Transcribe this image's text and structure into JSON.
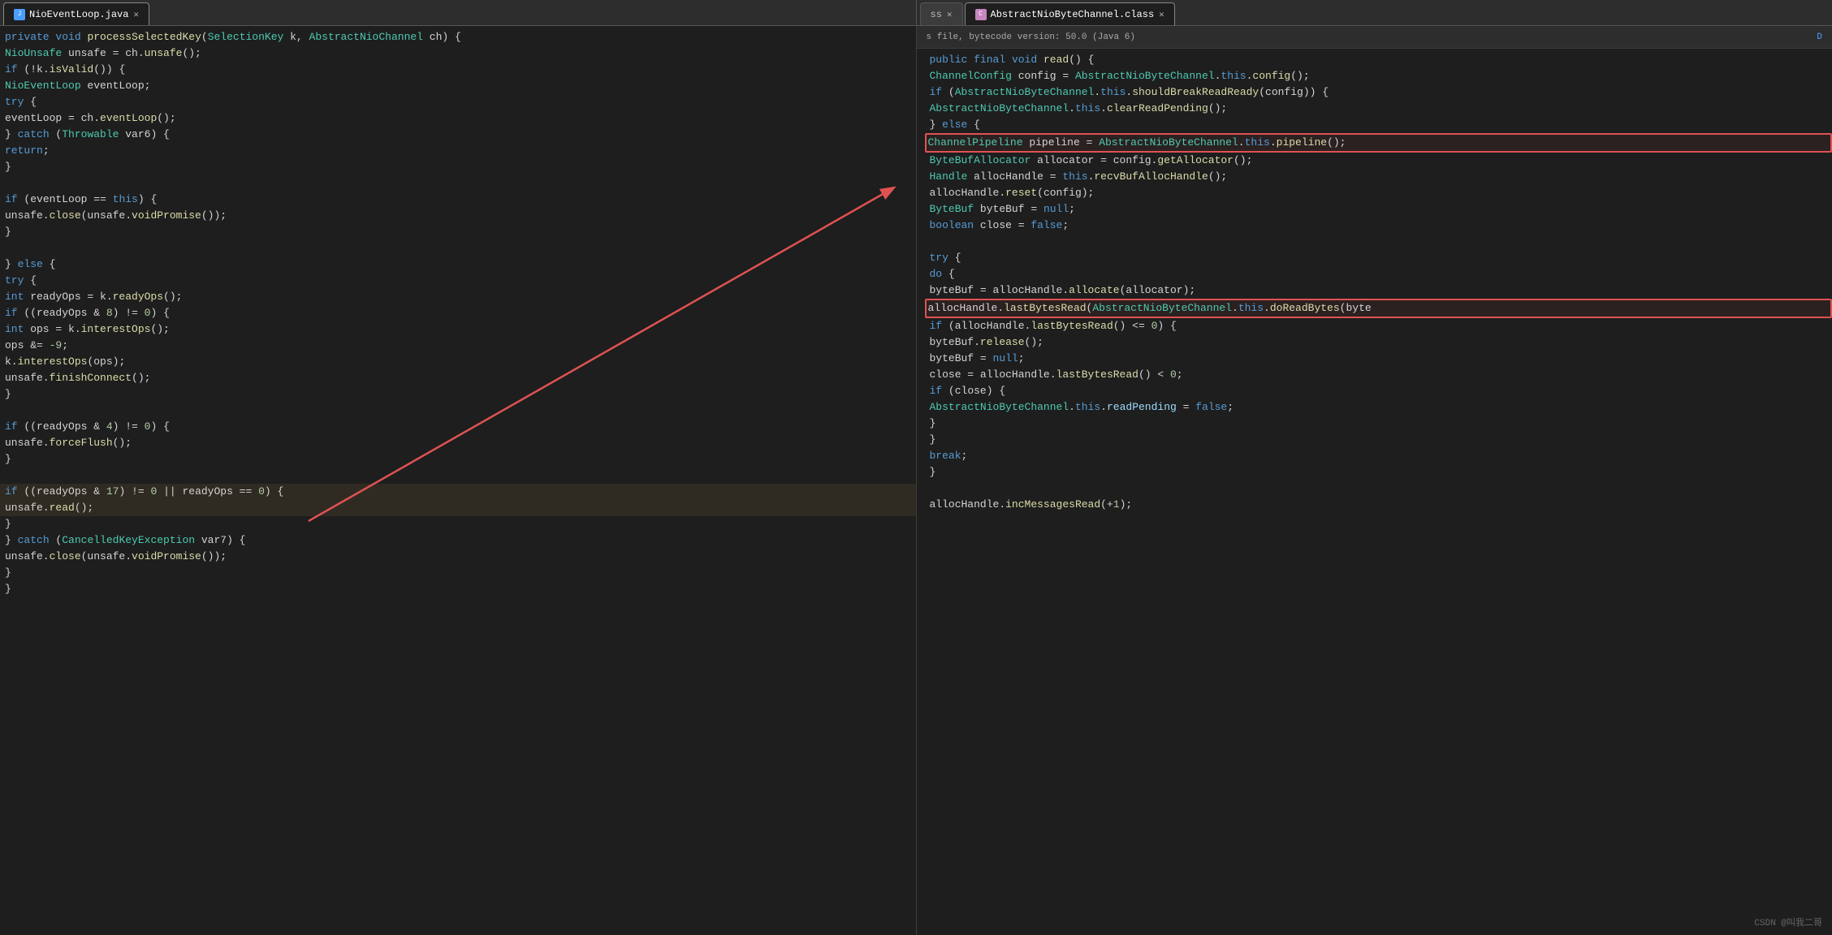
{
  "tabs": {
    "left": {
      "items": [
        {
          "label": "NioEventLoop.java",
          "active": false,
          "icon": "java"
        }
      ]
    },
    "right": {
      "items": [
        {
          "label": "ss",
          "active": false,
          "icon": "java"
        },
        {
          "label": "AbstractNioByteChannel.class",
          "active": true,
          "icon": "class"
        }
      ]
    }
  },
  "left_info": "private void processSelectedKey(SelectionKey k, AbstractNioChannel ch) {",
  "right_info": "s file, bytecode version: 50.0 (Java 6)",
  "right_badge": "D",
  "left_code": [
    {
      "num": "",
      "text": "private void processSelectedKey(SelectionKey k, AbstractNioChannel ch) {"
    },
    {
      "num": "",
      "text": "    NioUnsafe unsafe = ch.unsafe();"
    },
    {
      "num": "",
      "text": "    if (!k.isValid()) {"
    },
    {
      "num": "",
      "text": "        NioEventLoop eventLoop;"
    },
    {
      "num": "",
      "text": "        try {"
    },
    {
      "num": "",
      "text": "            eventLoop = ch.eventLoop();"
    },
    {
      "num": "",
      "text": "        } catch (Throwable var6) {"
    },
    {
      "num": "",
      "text": "            return;"
    },
    {
      "num": "",
      "text": "        }"
    },
    {
      "num": "",
      "text": ""
    },
    {
      "num": "",
      "text": "        if (eventLoop == this) {"
    },
    {
      "num": "",
      "text": "            unsafe.close(unsafe.voidPromise());"
    },
    {
      "num": "",
      "text": "        }"
    },
    {
      "num": "",
      "text": ""
    },
    {
      "num": "",
      "text": "    } else {"
    },
    {
      "num": "",
      "text": "        try {"
    },
    {
      "num": "",
      "text": "            int readyOps = k.readyOps();"
    },
    {
      "num": "",
      "text": "            if ((readyOps & 8) != 0) {"
    },
    {
      "num": "",
      "text": "                int ops = k.interestOps();"
    },
    {
      "num": "",
      "text": "                ops &= -9;"
    },
    {
      "num": "",
      "text": "                k.interestOps(ops);"
    },
    {
      "num": "",
      "text": "                unsafe.finishConnect();"
    },
    {
      "num": "",
      "text": "            }"
    },
    {
      "num": "",
      "text": ""
    },
    {
      "num": "",
      "text": "            if ((readyOps & 4) != 0) {"
    },
    {
      "num": "",
      "text": "                unsafe.forceFlush();"
    },
    {
      "num": "",
      "text": "            }"
    },
    {
      "num": "",
      "text": ""
    },
    {
      "num": "",
      "text": "            if ((readyOps & 17) != 0 || readyOps == 0) {"
    },
    {
      "num": "",
      "text": "                unsafe.read();"
    },
    {
      "num": "",
      "text": "            }"
    },
    {
      "num": "",
      "text": "        } catch (CancelledKeyException var7) {"
    },
    {
      "num": "",
      "text": "            unsafe.close(unsafe.voidPromise());"
    },
    {
      "num": "",
      "text": "        }"
    },
    {
      "num": "",
      "text": "    }"
    }
  ],
  "right_code": [
    {
      "text": "    public final void read() {"
    },
    {
      "text": "        ChannelConfig config = AbstractNioByteChannel.this.config();"
    },
    {
      "text": "        if (AbstractNioByteChannel.this.shouldBreakReadReady(config)) {"
    },
    {
      "text": "            AbstractNioByteChannel.this.clearReadPending();"
    },
    {
      "text": "        } else {"
    },
    {
      "text": "            ChannelPipeline pipeline = AbstractNioByteChannel.this.pipeline();",
      "box": true
    },
    {
      "text": "            ByteBufAllocator allocator = config.getAllocator();"
    },
    {
      "text": "            Handle allocHandle = this.recvBufAllocHandle();"
    },
    {
      "text": "            allocHandle.reset(config);"
    },
    {
      "text": "            ByteBuf byteBuf = null;"
    },
    {
      "text": "            boolean close = false;"
    },
    {
      "text": ""
    },
    {
      "text": "            try {"
    },
    {
      "text": "                do {"
    },
    {
      "text": "                    byteBuf = allocHandle.allocate(allocator);"
    },
    {
      "text": "                    allocHandle.lastBytesRead(AbstractNioByteChannel.this.doReadBytes(byte",
      "box": true
    },
    {
      "text": "                    if (allocHandle.lastBytesRead() <= 0) {"
    },
    {
      "text": "                        byteBuf.release();"
    },
    {
      "text": "                        byteBuf = null;"
    },
    {
      "text": "                        close = allocHandle.lastBytesRead() < 0;"
    },
    {
      "text": "                        if (close) {"
    },
    {
      "text": "                            AbstractNioByteChannel.this.readPending = false;"
    },
    {
      "text": "                        }"
    },
    {
      "text": "                    }"
    },
    {
      "text": "                    break;"
    },
    {
      "text": "                }"
    },
    {
      "text": ""
    },
    {
      "text": "        allocHandle.incMessagesRead(+1);"
    }
  ],
  "watermark": "CSDN @叫我二哥"
}
